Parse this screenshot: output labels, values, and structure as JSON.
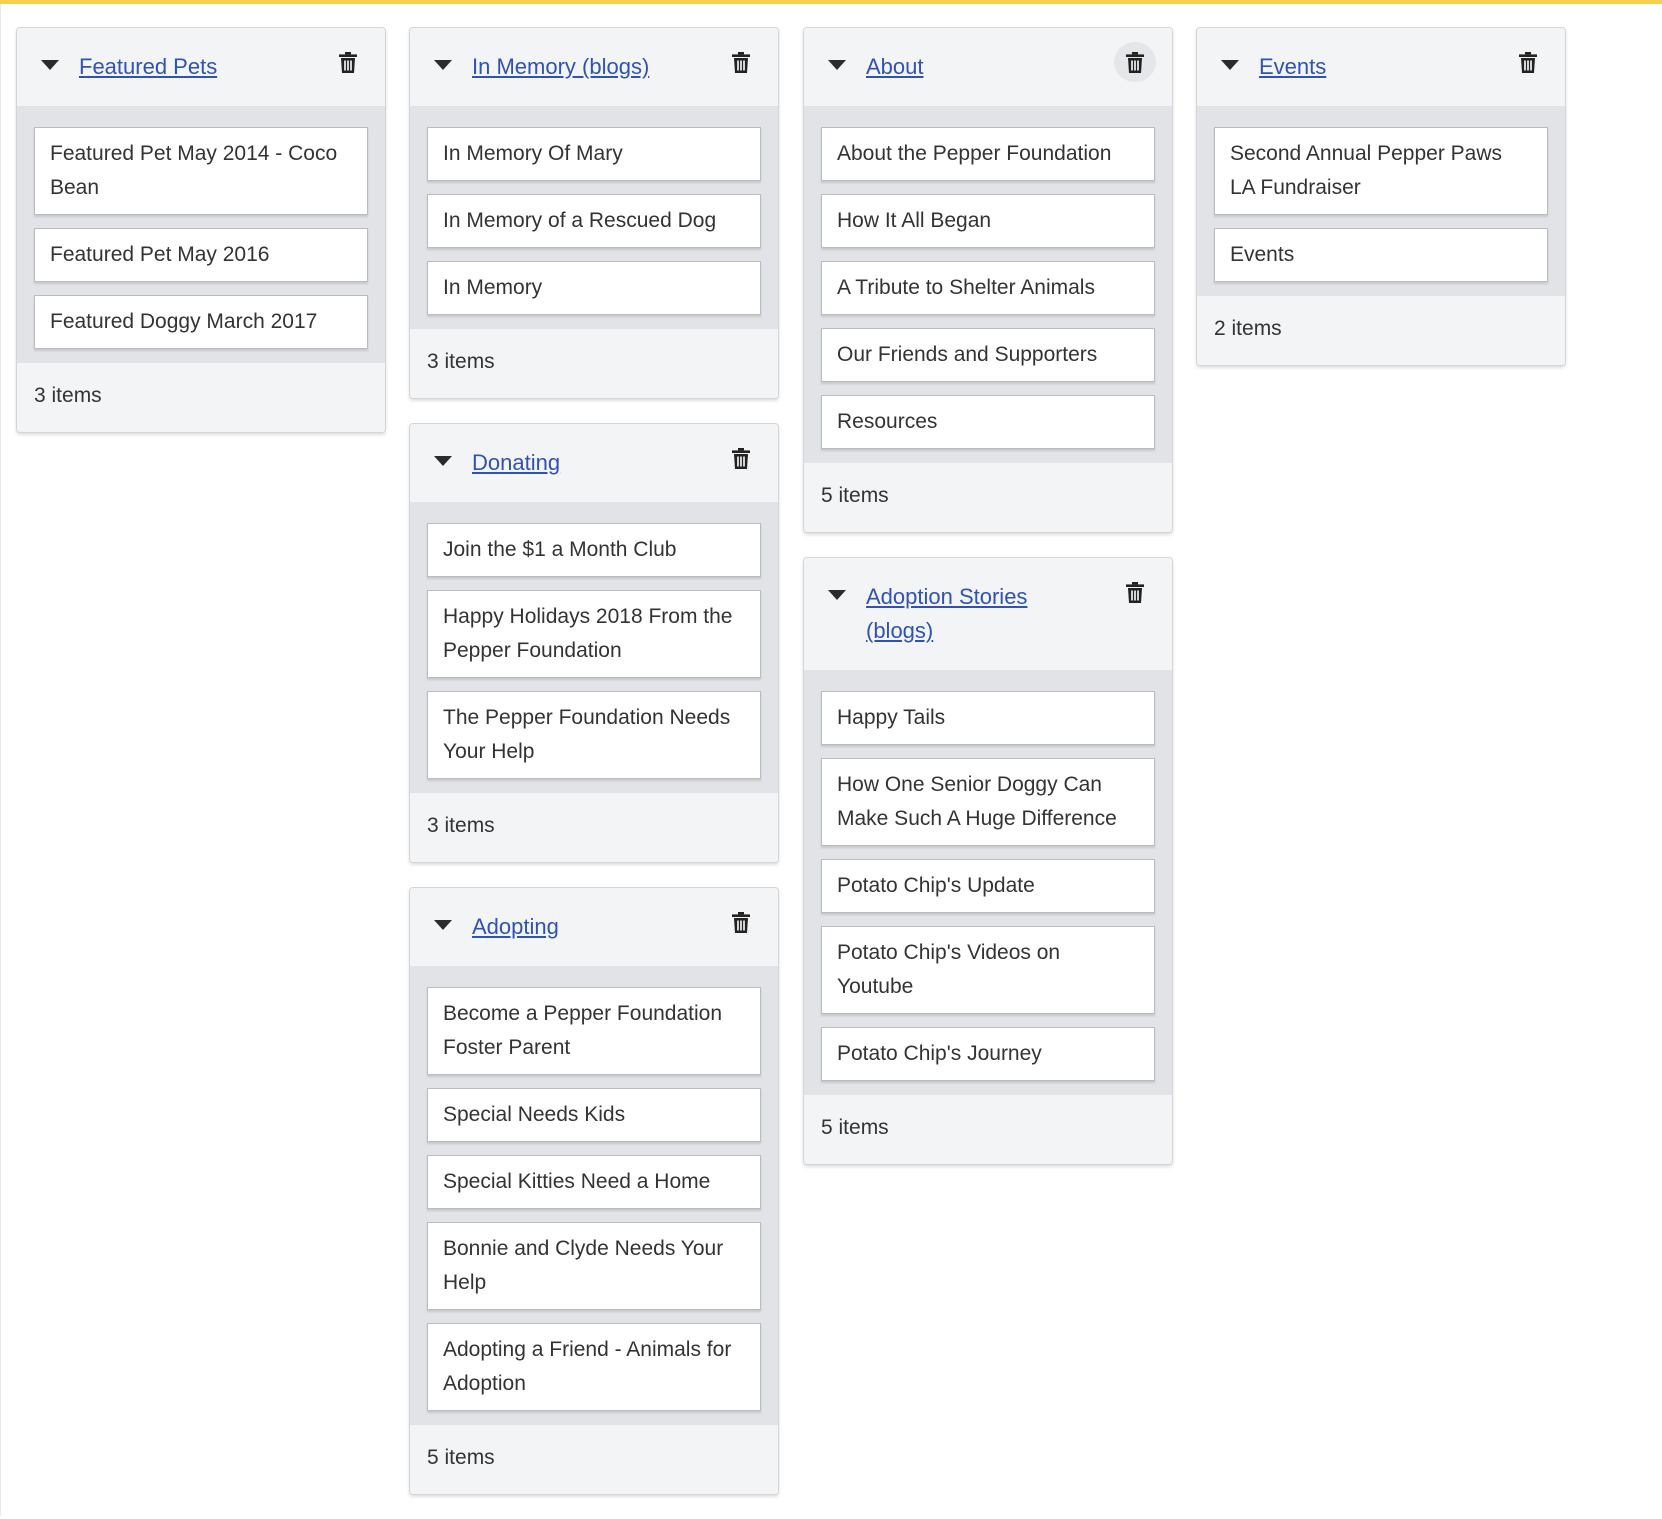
{
  "columns": [
    {
      "cards": [
        {
          "title": "Featured Pets",
          "items": [
            "Featured Pet May 2014 - Coco Bean",
            "Featured Pet May 2016",
            "Featured Doggy March 2017"
          ],
          "count": "3 items"
        }
      ]
    },
    {
      "cards": [
        {
          "title": "In Memory (blogs)",
          "items": [
            "In Memory Of Mary",
            "In Memory of a Rescued Dog",
            "In Memory"
          ],
          "count": "3 items"
        },
        {
          "title": "Donating",
          "items": [
            "Join the $1 a Month Club",
            "Happy Holidays 2018 From the Pepper Foundation",
            "The Pepper Foundation Needs Your Help"
          ],
          "count": "3 items"
        },
        {
          "title": "Adopting",
          "items": [
            "Become a Pepper Foundation Foster Parent",
            "Special Needs Kids",
            "Special Kitties Need a Home",
            "Bonnie and Clyde Needs Your Help",
            "Adopting a Friend - Animals for Adoption"
          ],
          "count": "5 items"
        }
      ]
    },
    {
      "cards": [
        {
          "title": "About",
          "items": [
            "About the Pepper Foundation",
            "How It All Began",
            "A Tribute to Shelter Animals",
            "Our Friends and Supporters",
            "Resources"
          ],
          "count": "5 items",
          "trash_hover": true
        },
        {
          "title": "Adoption Stories (blogs)",
          "items": [
            "Happy Tails",
            "How One Senior Doggy Can Make Such A Huge Difference",
            "Potato Chip's Update",
            "Potato Chip's Videos on Youtube",
            "Potato Chip's Journey"
          ],
          "count": "5 items"
        }
      ]
    },
    {
      "cards": [
        {
          "title": "Events",
          "items": [
            "Second Annual Pepper Paws LA Fundraiser",
            "Events"
          ],
          "count": "2 items"
        }
      ]
    }
  ],
  "icons": {
    "collapse": "caret-down-icon",
    "delete": "trash-icon"
  },
  "colors": {
    "accent_bar": "#f3d150",
    "link": "#2f52b4",
    "card_bg": "#f3f4f6",
    "list_bg": "#e2e3e7"
  }
}
